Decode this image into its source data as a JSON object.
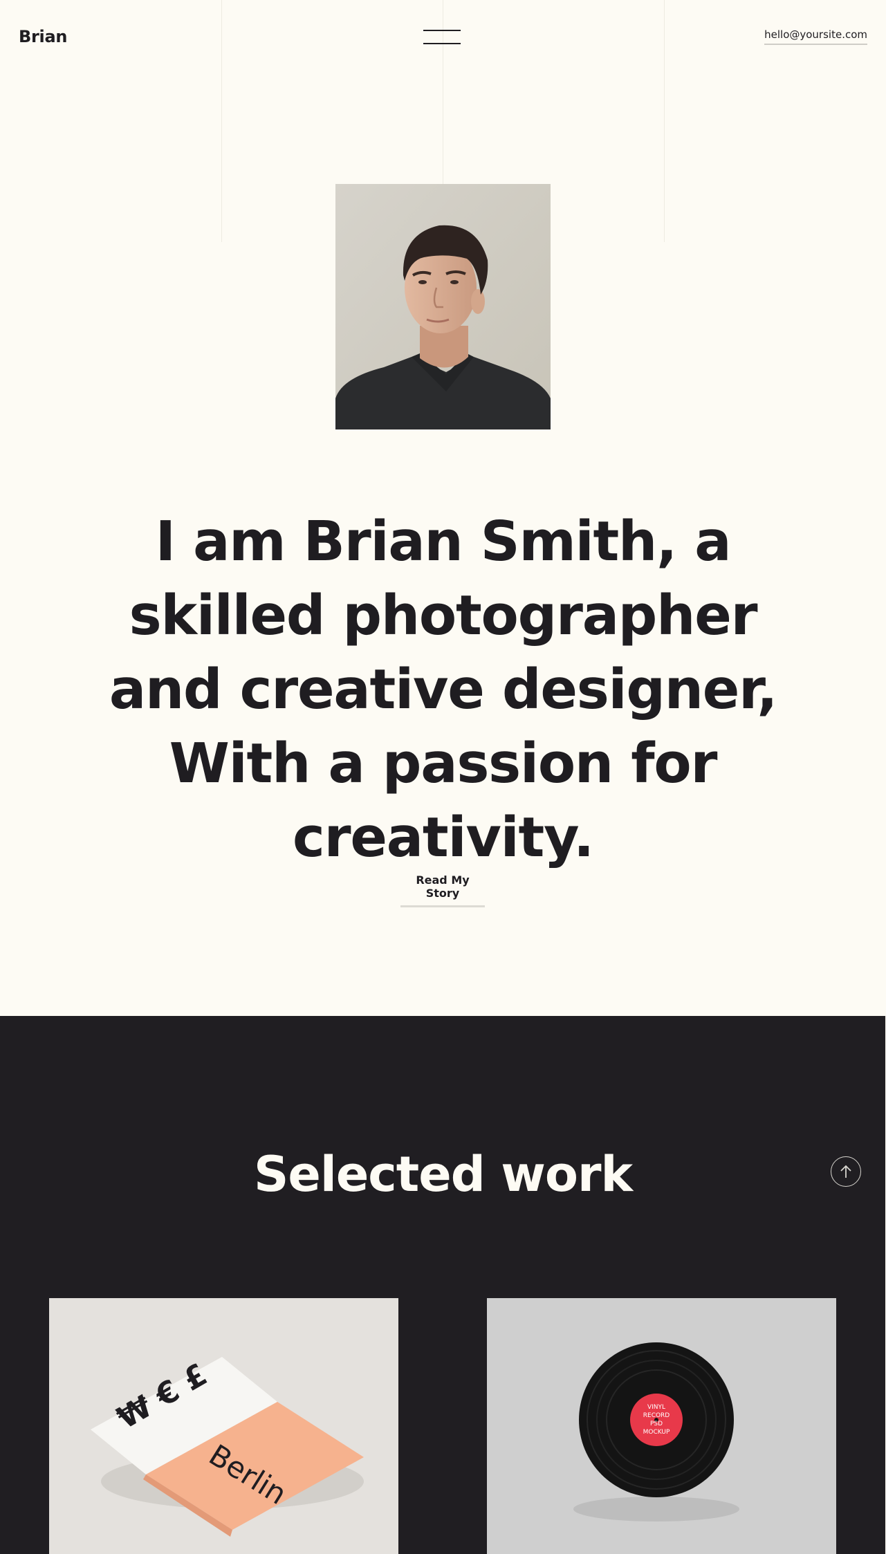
{
  "header": {
    "logo": "Brian",
    "menu_icon": "hamburger-icon",
    "email": "hello@yoursite.com"
  },
  "hero": {
    "portrait_alt": "Portrait of Brian Smith",
    "headline": "I am Brian Smith, a skilled photographer and creative designer, With a passion for creativity.",
    "cta_label": "Read My Story"
  },
  "work": {
    "title": "Selected work",
    "scroll_icon": "arrow-up-icon",
    "cards": [
      {
        "name": "berlin-brochure",
        "cover_text": "Berlin"
      },
      {
        "name": "vinyl-record",
        "label_line1": "VINYL",
        "label_line2": "RECORD",
        "label_line3": "PSD",
        "label_line4": "MOCKUP"
      }
    ]
  },
  "colors": {
    "background": "#fdfbf4",
    "text": "#1f1d21",
    "dark_section": "#201e22",
    "accent_red": "#e8394a",
    "accent_peach": "#f6b28e"
  }
}
